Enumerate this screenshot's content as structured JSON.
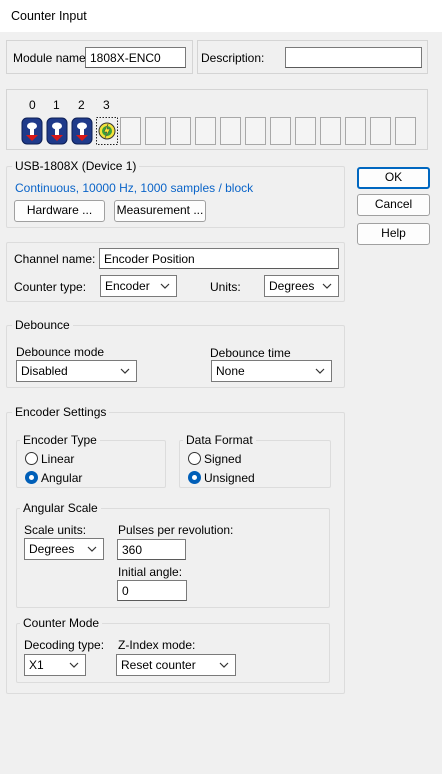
{
  "window": {
    "title": "Counter Input"
  },
  "module": {
    "name_label": "Module name:",
    "name_value": "1808X-ENC0",
    "description_label": "Description:",
    "description_value": ""
  },
  "channels": {
    "numbers": [
      "0",
      "1",
      "2",
      "3"
    ],
    "selected": "3"
  },
  "device": {
    "title": "USB-1808X (Device 1)",
    "status": "Continuous, 10000 Hz, 1000 samples / block",
    "hardware_button": "Hardware ...",
    "measurement_button": "Measurement ..."
  },
  "actions": {
    "ok": "OK",
    "cancel": "Cancel",
    "help": "Help"
  },
  "channel": {
    "name_label": "Channel name:",
    "name_value": "Encoder Position",
    "type_label": "Counter type:",
    "type_value": "Encoder",
    "units_label": "Units:",
    "units_value": "Degrees"
  },
  "debounce": {
    "title": "Debounce",
    "mode_label": "Debounce mode",
    "mode_value": "Disabled",
    "time_label": "Debounce time",
    "time_value": "None"
  },
  "encoder": {
    "title": "Encoder Settings",
    "type_title": "Encoder Type",
    "linear": "Linear",
    "angular": "Angular",
    "format_title": "Data Format",
    "signed": "Signed",
    "unsigned": "Unsigned",
    "scale": {
      "title": "Angular Scale",
      "units_label": "Scale units:",
      "units_value": "Degrees",
      "ppr_label": "Pulses per revolution:",
      "ppr_value": "360",
      "initial_label": "Initial angle:",
      "initial_value": "0"
    },
    "mode": {
      "title": "Counter Mode",
      "decoding_label": "Decoding type:",
      "decoding_value": "X1",
      "zindex_label": "Z-Index mode:",
      "zindex_value": "Reset counter"
    }
  },
  "colors": {
    "accent": "#005fb8",
    "link_text": "#0a64c8"
  }
}
